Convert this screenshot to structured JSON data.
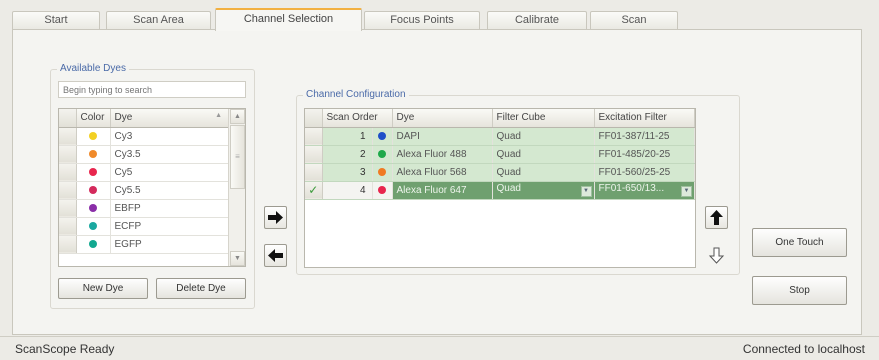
{
  "tabs": [
    {
      "label": "Start"
    },
    {
      "label": "Scan Area"
    },
    {
      "label": "Channel Selection"
    },
    {
      "label": "Focus Points"
    },
    {
      "label": "Calibrate"
    },
    {
      "label": "Scan"
    }
  ],
  "active_tab": "Channel Selection",
  "available_dyes": {
    "title": "Available Dyes",
    "search_placeholder": "Begin typing to search",
    "columns": {
      "color": "Color",
      "dye": "Dye"
    },
    "rows": [
      {
        "name": "Cy3",
        "color": "#f2d023"
      },
      {
        "name": "Cy3.5",
        "color": "#f08a2a"
      },
      {
        "name": "Cy5",
        "color": "#e8264e"
      },
      {
        "name": "Cy5.5",
        "color": "#d42a5c"
      },
      {
        "name": "EBFP",
        "color": "#8a2ea8"
      },
      {
        "name": "ECFP",
        "color": "#1aa8a0"
      },
      {
        "name": "EGFP",
        "color": "#12a890"
      }
    ],
    "new_dye_label": "New Dye",
    "delete_dye_label": "Delete Dye"
  },
  "channel_config": {
    "title": "Channel Configuration",
    "columns": {
      "scan_order": "Scan Order",
      "dye": "Dye",
      "filter_cube": "Filter Cube",
      "excitation_filter": "Excitation Filter"
    },
    "rows": [
      {
        "order": "1",
        "color": "#1f4fc8",
        "dye": "DAPI",
        "filter_cube": "Quad",
        "excitation": "FF01-387/11-25"
      },
      {
        "order": "2",
        "color": "#1fa84a",
        "dye": "Alexa Fluor 488",
        "filter_cube": "Quad",
        "excitation": "FF01-485/20-25"
      },
      {
        "order": "3",
        "color": "#f07a22",
        "dye": "Alexa Fluor 568",
        "filter_cube": "Quad",
        "excitation": "FF01-560/25-25"
      },
      {
        "order": "4",
        "color": "#e8264e",
        "dye": "Alexa Fluor 647",
        "filter_cube": "Quad",
        "excitation": "FF01-650/13..."
      }
    ]
  },
  "buttons": {
    "one_touch": "One Touch",
    "stop": "Stop"
  },
  "status": {
    "left": "ScanScope Ready",
    "right": "Connected to localhost"
  }
}
